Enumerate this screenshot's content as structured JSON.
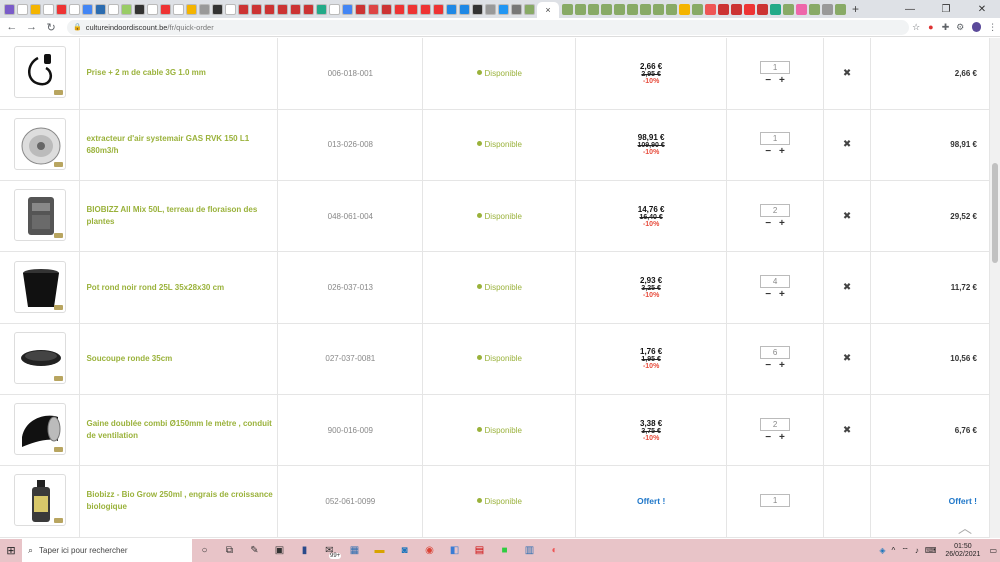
{
  "browser": {
    "url_host": "cultureindoordiscount.be",
    "url_path": "/fr/quick-order",
    "close_tab": "×",
    "new_tab": "+"
  },
  "products": [
    {
      "name": "Prise + 2 m de cable 3G 1.0 mm",
      "ref": "006-018-001",
      "availability": "Disponible",
      "price": "2,66 €",
      "old_price": "2,95 €",
      "discount": "-10%",
      "qty": "1",
      "total": "2,66 €",
      "icon": "cable-icon"
    },
    {
      "name": "extracteur d'air systemair GAS RVK 150 L1 680m3/h",
      "ref": "013-026-008",
      "availability": "Disponible",
      "price": "98,91 €",
      "old_price": "109,90 €",
      "discount": "-10%",
      "qty": "1",
      "total": "98,91 €",
      "icon": "fan-icon"
    },
    {
      "name": "BIOBIZZ All Mix 50L, terreau de floraison des plantes",
      "ref": "048-061-004",
      "availability": "Disponible",
      "price": "14,76 €",
      "old_price": "16,40 €",
      "discount": "-10%",
      "qty": "2",
      "total": "29,52 €",
      "icon": "soil-bag-icon"
    },
    {
      "name": "Pot rond noir rond 25L 35x28x30 cm",
      "ref": "026-037-013",
      "availability": "Disponible",
      "price": "2,93 €",
      "old_price": "3,25 €",
      "discount": "-10%",
      "qty": "4",
      "total": "11,72 €",
      "icon": "pot-icon"
    },
    {
      "name": "Soucoupe ronde 35cm",
      "ref": "027-037-0081",
      "availability": "Disponible",
      "price": "1,76 €",
      "old_price": "1,95 €",
      "discount": "-10%",
      "qty": "6",
      "total": "10,56 €",
      "icon": "saucer-icon"
    },
    {
      "name": "Gaine doublée combi Ø150mm le mètre , conduit de ventilation",
      "ref": "900-016-009",
      "availability": "Disponible",
      "price": "3,38 €",
      "old_price": "3,75 €",
      "discount": "-10%",
      "qty": "2",
      "total": "6,76 €",
      "icon": "duct-icon"
    },
    {
      "name": "Biobizz - Bio Grow 250ml , engrais de croissance biologique",
      "ref": "052-061-0099",
      "availability": "Disponible",
      "price": "Offert !",
      "old_price": "",
      "discount": "",
      "qty": "1",
      "total": "Offert !",
      "icon": "bottle-icon",
      "free": true
    }
  ],
  "taskbar": {
    "search_placeholder": "Taper ici pour rechercher",
    "time": "01:50",
    "date": "26/02/2021",
    "badge": "99+"
  },
  "colors": {
    "accent_green": "#9ab23b",
    "discount_red": "#e74c3c",
    "free_blue": "#1f77c9"
  }
}
